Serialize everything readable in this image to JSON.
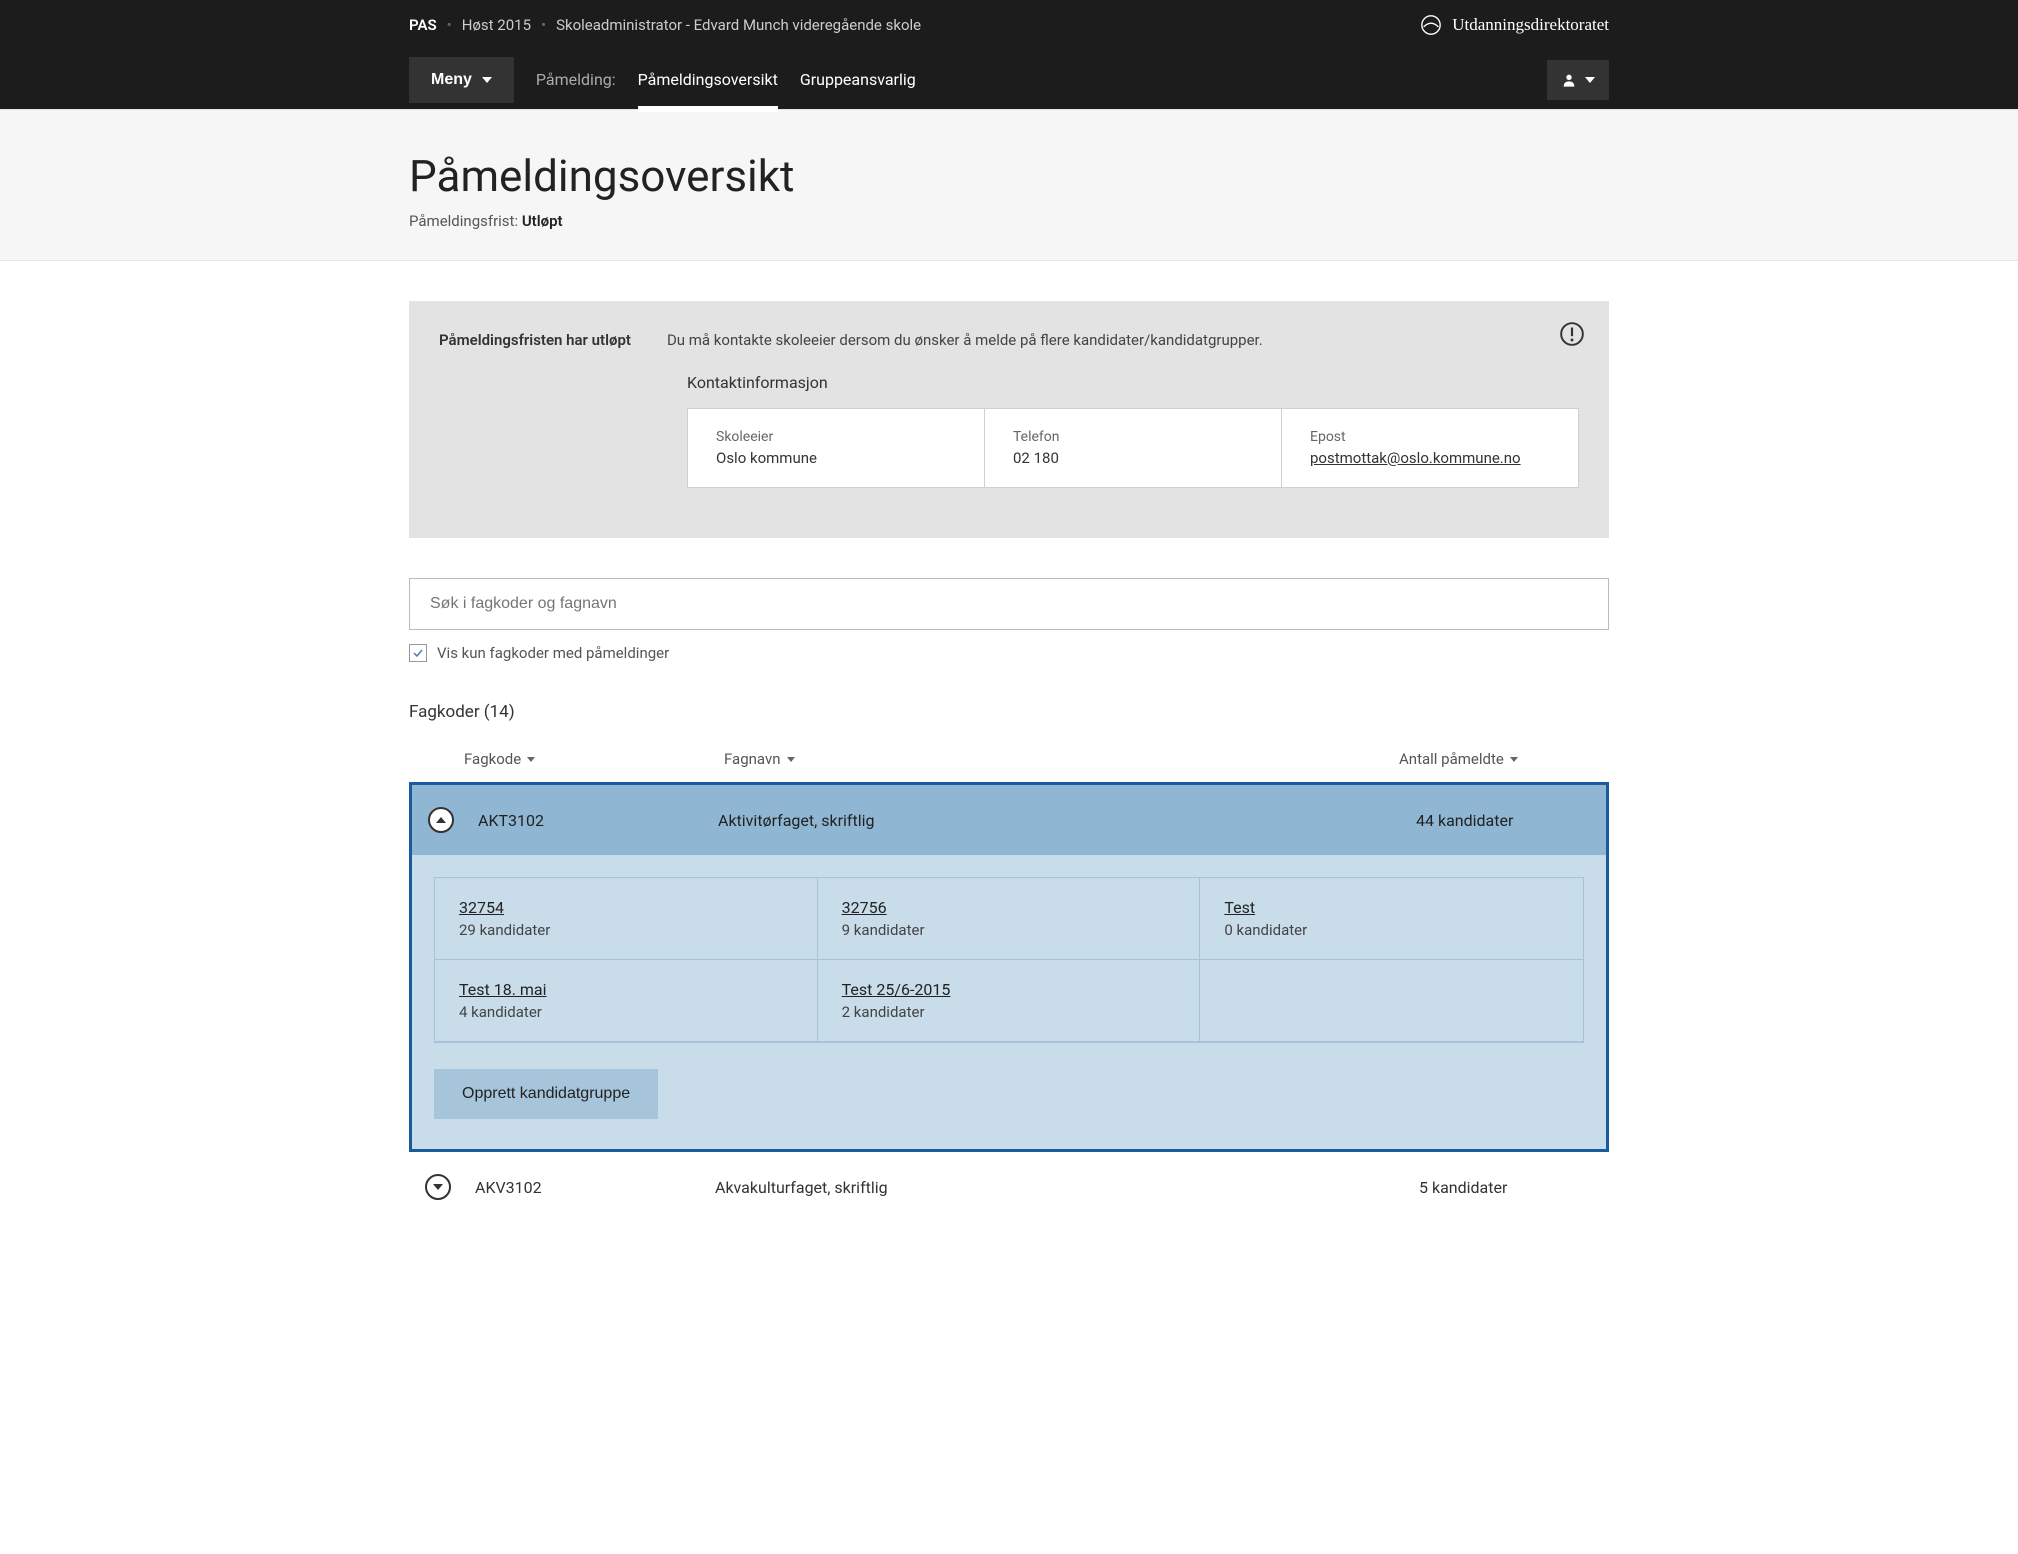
{
  "breadcrumb": {
    "app": "PAS",
    "term": "Høst 2015",
    "role": "Skoleadministrator - Edvard Munch videregående skole"
  },
  "brand": "Utdanningsdirektoratet",
  "nav": {
    "menu_label": "Meny",
    "section_label": "Påmelding:",
    "link_overview": "Påmeldingsoversikt",
    "link_group": "Gruppeansvarlig"
  },
  "header": {
    "title": "Påmeldingsoversikt",
    "deadline_label": "Påmeldingsfrist:",
    "deadline_value": "Utløpt"
  },
  "notice": {
    "title": "Påmeldingsfristen har utløpt",
    "message": "Du må kontakte skoleeier dersom du ønsker å melde på flere kandidater/kandidatgrupper.",
    "contact_heading": "Kontaktinformasjon",
    "owner_label": "Skoleeier",
    "owner_value": "Oslo kommune",
    "phone_label": "Telefon",
    "phone_value": "02 180",
    "email_label": "Epost",
    "email_value": "postmottak@oslo.kommune.no"
  },
  "search": {
    "placeholder": "Søk i fagkoder og fagnavn"
  },
  "filter": {
    "checkbox_label": "Vis kun fagkoder med påmeldinger"
  },
  "list": {
    "heading": "Fagkoder (14)",
    "col_code": "Fagkode",
    "col_name": "Fagnavn",
    "col_count": "Antall påmeldte"
  },
  "rows": [
    {
      "code": "AKT3102",
      "name": "Aktivitørfaget, skriftlig",
      "count": "44 kandidater",
      "expanded": true,
      "groups": [
        {
          "name": "32754",
          "count": "29 kandidater"
        },
        {
          "name": "32756",
          "count": "9 kandidater"
        },
        {
          "name": "Test",
          "count": "0 kandidater"
        },
        {
          "name": "Test 18. mai",
          "count": "4 kandidater"
        },
        {
          "name": "Test 25/6-2015",
          "count": "2 kandidater"
        },
        {
          "name": "",
          "count": ""
        }
      ],
      "create_label": "Opprett kandidatgruppe"
    },
    {
      "code": "AKV3102",
      "name": "Akvakulturfaget, skriftlig",
      "count": "5 kandidater",
      "expanded": false
    }
  ]
}
